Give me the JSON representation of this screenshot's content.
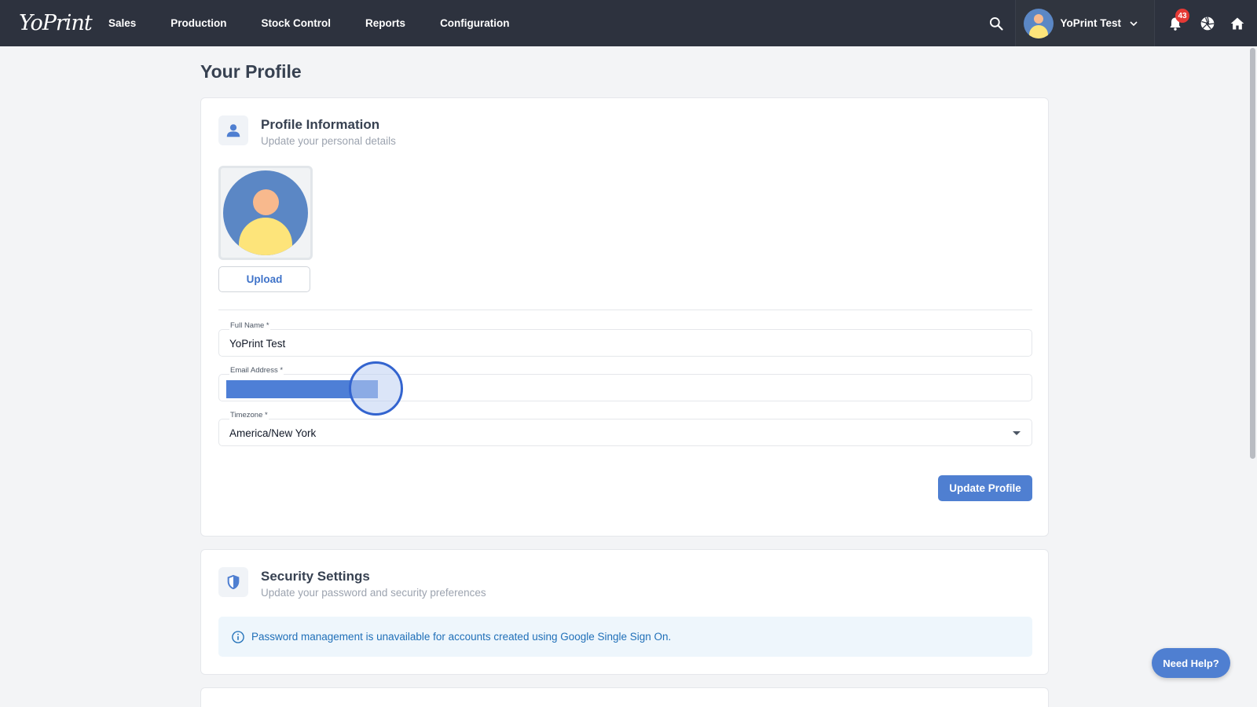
{
  "app": {
    "logo_text": "YoPrint"
  },
  "nav": {
    "items": [
      {
        "label": "Sales"
      },
      {
        "label": "Production"
      },
      {
        "label": "Stock Control"
      },
      {
        "label": "Reports"
      },
      {
        "label": "Configuration"
      }
    ]
  },
  "user_menu": {
    "name": "YoPrint Test",
    "notification_count": "43"
  },
  "page": {
    "title": "Your Profile"
  },
  "profile_section": {
    "title": "Profile Information",
    "subtitle": "Update your personal details",
    "upload_label": "Upload",
    "fields": {
      "full_name": {
        "label": "Full Name *",
        "value": "YoPrint Test"
      },
      "email": {
        "label": "Email Address *",
        "value": ""
      },
      "timezone": {
        "label": "Timezone *",
        "value": "America/New York"
      }
    },
    "update_label": "Update Profile"
  },
  "security_section": {
    "title": "Security Settings",
    "subtitle": "Update your password and security preferences",
    "notice": "Password management is unavailable for accounts created using Google Single Sign On."
  },
  "help": {
    "label": "Need Help?"
  },
  "colors": {
    "topbar": "#2d323e",
    "accent": "#4f7fd1",
    "notice_bg": "#eef6fc",
    "notice_text": "#1f6fb8",
    "badge": "#e53935"
  }
}
